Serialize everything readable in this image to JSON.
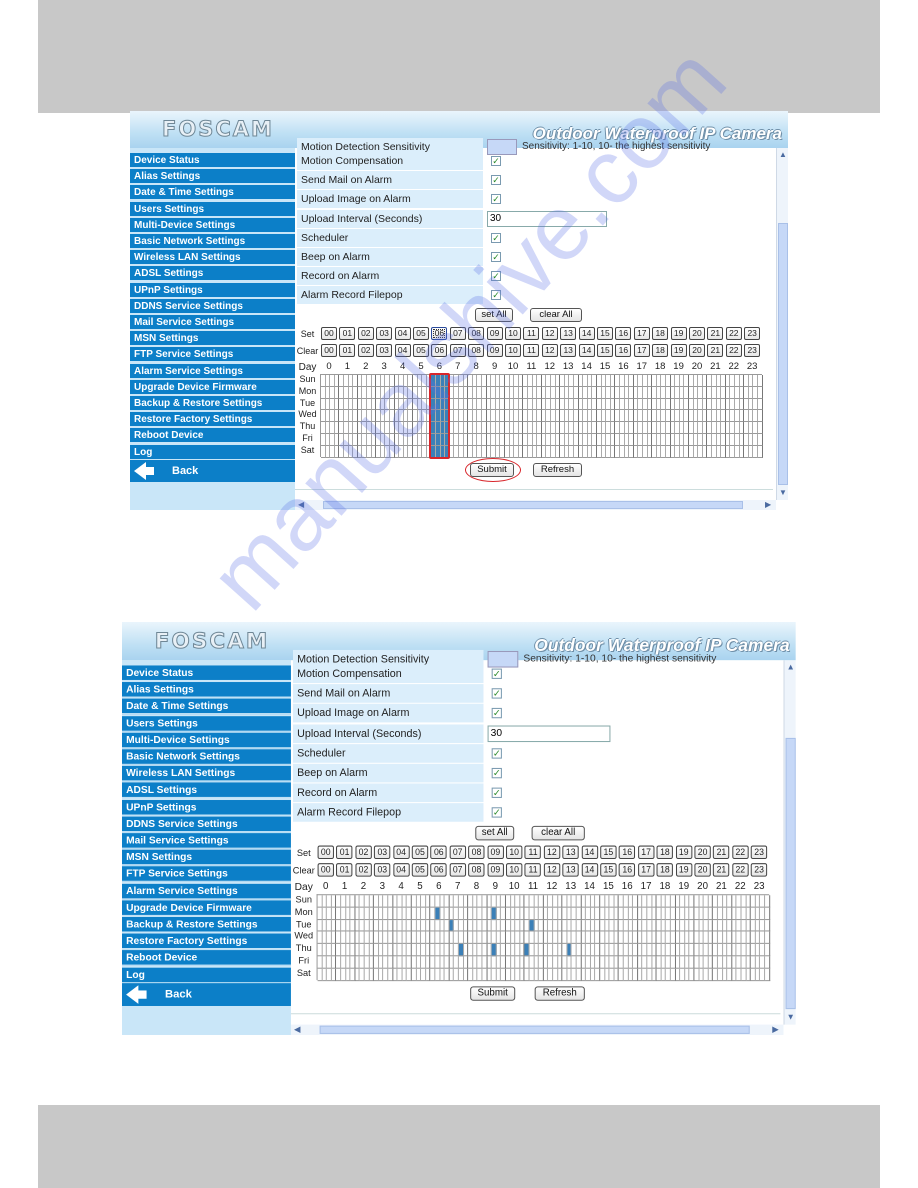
{
  "ui": {
    "logo": "FOSCAM",
    "tagline": "Outdoor Waterproof IP Camera",
    "sidebar": [
      "Device Status",
      "Alias Settings",
      "Date & Time Settings",
      "Users Settings",
      "Multi-Device Settings",
      "Basic Network Settings",
      "Wireless LAN Settings",
      "ADSL Settings",
      "UPnP Settings",
      "DDNS Service Settings",
      "Mail Service Settings",
      "MSN Settings",
      "FTP Service Settings",
      "Alarm Service Settings",
      "Upgrade Device Firmware",
      "Backup & Restore Settings",
      "Restore Factory Settings",
      "Reboot Device",
      "Log"
    ],
    "back_label": "Back",
    "cut_row": {
      "label": "Motion Detection Sensitivity",
      "hint": "Sensitivity: 1-10, 10- the highest sensitivity"
    },
    "form_rows": [
      {
        "label": "Motion Compensation",
        "type": "checkbox",
        "checked": true
      },
      {
        "label": "Send Mail on Alarm",
        "type": "checkbox",
        "checked": true
      },
      {
        "label": "Upload Image on Alarm",
        "type": "checkbox",
        "checked": true
      },
      {
        "label": "Upload Interval (Seconds)",
        "type": "text",
        "value": "30"
      },
      {
        "label": "Scheduler",
        "type": "checkbox",
        "checked": true
      },
      {
        "label": "Beep on Alarm",
        "type": "checkbox",
        "checked": true
      },
      {
        "label": "Record on Alarm",
        "type": "checkbox",
        "checked": true
      },
      {
        "label": "Alarm Record Filepop",
        "type": "checkbox",
        "checked": true
      }
    ],
    "set_all": "set All",
    "clear_all": "clear All",
    "set_label": "Set",
    "clear_label": "Clear",
    "day_label": "Day",
    "hours": [
      "00",
      "01",
      "02",
      "03",
      "04",
      "05",
      "06",
      "07",
      "08",
      "09",
      "10",
      "11",
      "12",
      "13",
      "14",
      "15",
      "16",
      "17",
      "18",
      "19",
      "20",
      "21",
      "22",
      "23"
    ],
    "hour_numbers": [
      "0",
      "1",
      "2",
      "3",
      "4",
      "5",
      "6",
      "7",
      "8",
      "9",
      "10",
      "11",
      "12",
      "13",
      "14",
      "15",
      "16",
      "17",
      "18",
      "19",
      "20",
      "21",
      "22",
      "23"
    ],
    "days": [
      "Sun",
      "Mon",
      "Tue",
      "Wed",
      "Thu",
      "Fri",
      "Sat"
    ],
    "submit": "Submit",
    "refresh": "Refresh",
    "highlight_color": "#d8262b",
    "selected_color": "#3b80b8"
  },
  "screenshots": [
    {
      "focused_set_hour": "06",
      "highlight_hour_column": 6,
      "highlight_submit": true,
      "selected_cells": {
        "all_days_hours": [
          6
        ]
      }
    },
    {
      "selected_cells": {
        "quarters": [
          {
            "day": "Mon",
            "hour": 6,
            "quarter": 1
          },
          {
            "day": "Mon",
            "hour": 9,
            "quarter": 1
          },
          {
            "day": "Tue",
            "hour": 7,
            "quarter": 0
          },
          {
            "day": "Tue",
            "hour": 11,
            "quarter": 1
          },
          {
            "day": "Thu",
            "hour": 7,
            "quarter": 2
          },
          {
            "day": "Thu",
            "hour": 9,
            "quarter": 1
          },
          {
            "day": "Thu",
            "hour": 11,
            "quarter": 0
          },
          {
            "day": "Thu",
            "hour": 13,
            "quarter": 1
          }
        ]
      }
    }
  ],
  "watermark": "manualshive.com"
}
